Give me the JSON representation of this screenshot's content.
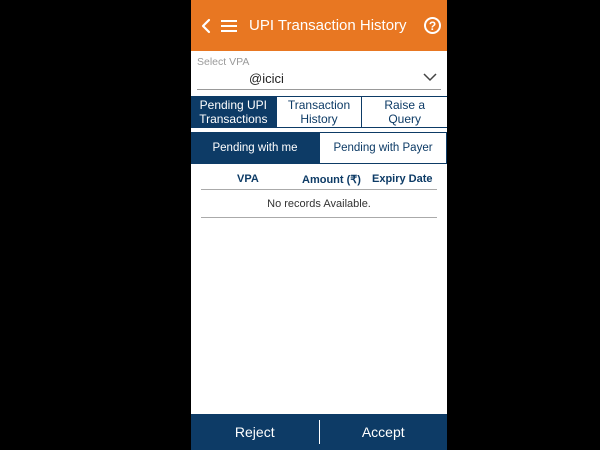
{
  "header": {
    "title": "UPI Transaction History",
    "back_icon": "chevron-left-icon",
    "menu_icon": "hamburger-menu-icon",
    "help_icon": "help-circle-icon",
    "help_glyph": "?",
    "color": "#e87722"
  },
  "vpa": {
    "label": "Select VPA",
    "value": "@icici",
    "dropdown_icon": "chevron-down-icon"
  },
  "tabs": [
    {
      "label": "Pending UPI Transactions",
      "active": true
    },
    {
      "label": "Transaction History",
      "active": false
    },
    {
      "label": "Raise a Query",
      "active": false
    }
  ],
  "subtabs": [
    {
      "label": "Pending with me",
      "active": true
    },
    {
      "label": "Pending with Payer",
      "active": false
    }
  ],
  "table": {
    "columns": [
      "VPA",
      "Amount (₹)",
      "Expiry Date"
    ],
    "empty_message": "No records Available."
  },
  "actions": {
    "reject_label": "Reject",
    "accept_label": "Accept"
  },
  "colors": {
    "primary": "#0d3b66",
    "accent": "#e87722"
  }
}
